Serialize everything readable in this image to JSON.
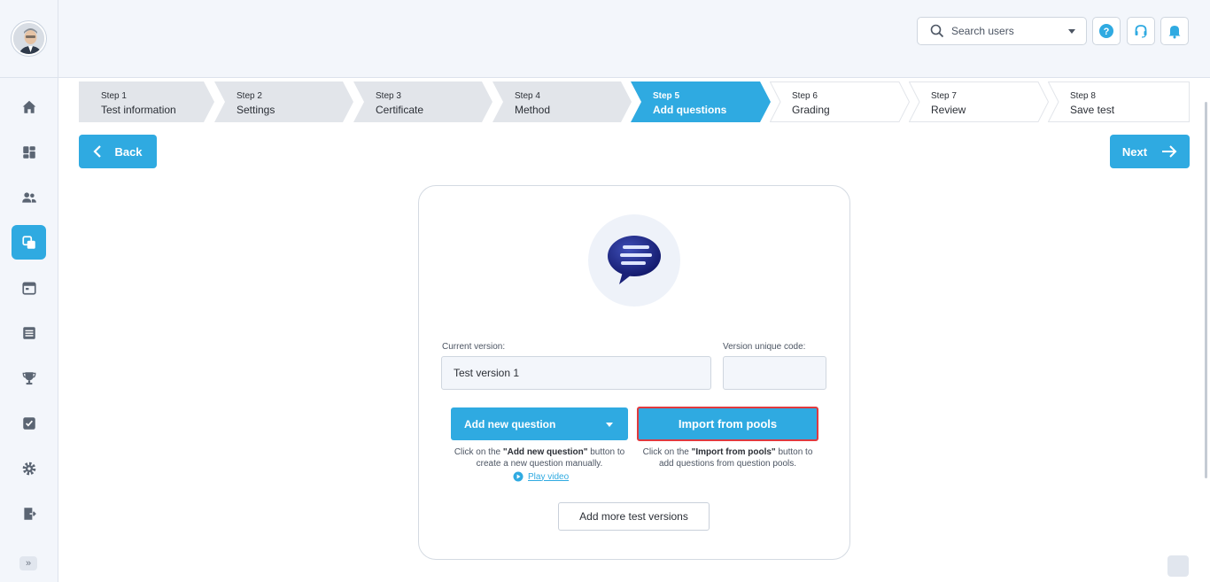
{
  "header": {
    "search_placeholder": "Search users",
    "help_icon": "question-circle-icon",
    "support_icon": "headset-icon",
    "notification_icon": "bell-icon"
  },
  "sidebar": {
    "items": [
      {
        "icon": "home-icon"
      },
      {
        "icon": "dashboard-icon"
      },
      {
        "icon": "users-icon"
      },
      {
        "icon": "tests-icon",
        "active": true
      },
      {
        "icon": "calendar-icon"
      },
      {
        "icon": "list-icon"
      },
      {
        "icon": "trophy-icon"
      },
      {
        "icon": "checkbox-icon"
      },
      {
        "icon": "gear-icon"
      },
      {
        "icon": "logout-icon"
      }
    ],
    "expand_label": "»"
  },
  "stepper": {
    "steps": [
      {
        "label": "Step 1",
        "name": "Test information",
        "state": "done"
      },
      {
        "label": "Step 2",
        "name": "Settings",
        "state": "done"
      },
      {
        "label": "Step 3",
        "name": "Certificate",
        "state": "done"
      },
      {
        "label": "Step 4",
        "name": "Method",
        "state": "done"
      },
      {
        "label": "Step 5",
        "name": "Add questions",
        "state": "current"
      },
      {
        "label": "Step 6",
        "name": "Grading",
        "state": "future"
      },
      {
        "label": "Step 7",
        "name": "Review",
        "state": "future"
      },
      {
        "label": "Step 8",
        "name": "Save test",
        "state": "future"
      }
    ]
  },
  "nav": {
    "back_label": "Back",
    "next_label": "Next"
  },
  "card": {
    "current_version_label": "Current version:",
    "current_version_value": "Test version 1",
    "unique_code_label": "Version unique code:",
    "unique_code_value": "",
    "add_question_label": "Add new question",
    "import_label": "Import from pools",
    "add_help_prefix": "Click on the ",
    "add_help_bold": "\"Add new question\"",
    "add_help_suffix": " button to create a new question manually.",
    "import_help_prefix": "Click on the ",
    "import_help_bold": "\"Import from pools\"",
    "import_help_suffix": " button to add questions from question pools.",
    "play_video_label": "Play video",
    "add_versions_label": "Add more test versions"
  },
  "colors": {
    "accent": "#2faae1",
    "highlight_border": "#e0393e",
    "step_done": "#e2e5ea",
    "step_future": "#ffffff"
  }
}
